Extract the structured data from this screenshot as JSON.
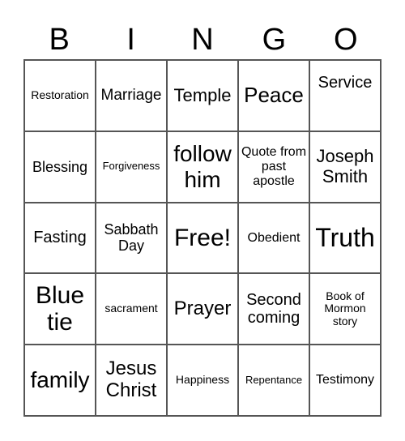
{
  "header": {
    "letters": [
      "B",
      "I",
      "N",
      "G",
      "O"
    ]
  },
  "card": {
    "rows": [
      [
        "Restoration",
        "Marriage",
        "Temple",
        "Peace",
        "Service"
      ],
      [
        "Blessing",
        "Forgiveness",
        "follow him",
        "Quote from past apostle",
        "Joseph Smith"
      ],
      [
        "Fasting",
        "Sabbath Day",
        "Free!",
        "Obedient",
        "Truth"
      ],
      [
        "Blue tie",
        "sacrament",
        "Prayer",
        "Second coming",
        "Book of Mormon story"
      ],
      [
        "family",
        "Jesus Christ",
        "Happiness",
        "Repentance",
        "Testimony"
      ]
    ]
  }
}
